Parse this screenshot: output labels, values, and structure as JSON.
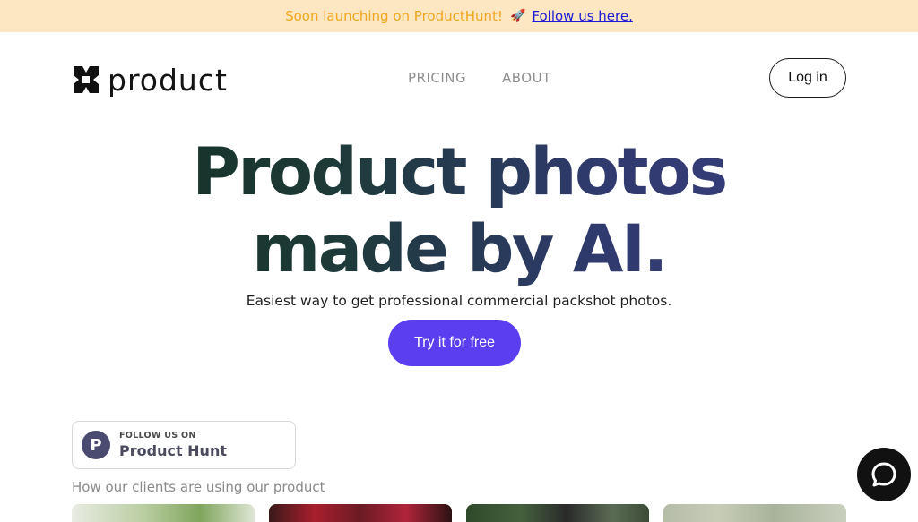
{
  "banner": {
    "text": "Soon launching on ProductHunt!",
    "emoji": "🚀",
    "link_label": "Follow us here."
  },
  "brand": {
    "name": "product",
    "logo_icon": "product-logo-icon"
  },
  "nav": {
    "items": [
      {
        "label": "PRICING"
      },
      {
        "label": "ABOUT"
      }
    ],
    "login_label": "Log in"
  },
  "hero": {
    "title_line1": "Product photos",
    "title_line2": "made by AI.",
    "subtitle": "Easiest way to get professional commercial packshot photos.",
    "cta_label": "Try it for free"
  },
  "product_hunt_badge": {
    "small_text": "FOLLOW US ON",
    "big_text": "Product Hunt",
    "logo_letter": "P"
  },
  "clients": {
    "label": "How our clients are using our product"
  },
  "chat_widget": {
    "icon": "chat-bubble-icon"
  },
  "colors": {
    "banner_bg": "#fde7c2",
    "banner_text": "#f2a51d",
    "cta_bg": "#5b3ef0",
    "product_hunt_logo": "#4b4b72",
    "chat_bg": "#111111"
  }
}
